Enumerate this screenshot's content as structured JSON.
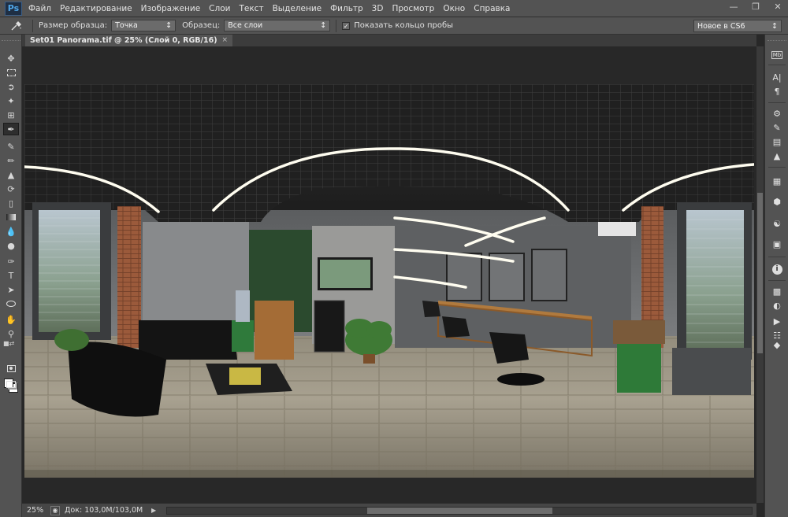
{
  "app": {
    "logo": "Ps"
  },
  "menu": [
    "Файл",
    "Редактирование",
    "Изображение",
    "Слои",
    "Текст",
    "Выделение",
    "Фильтр",
    "3D",
    "Просмотр",
    "Окно",
    "Справка"
  ],
  "window_controls": [
    "minimize-icon",
    "restore-icon",
    "close-icon"
  ],
  "options": {
    "tool_icon": "eyedropper-icon",
    "sample_size_label": "Размер образца:",
    "sample_size_value": "Точка",
    "sample_label": "Образец:",
    "sample_value": "Все слои",
    "show_ring_label": "Показать кольцо пробы",
    "show_ring_checked": true,
    "workspace_value": "Новое в CS6"
  },
  "document": {
    "tab_title": "Set01 Panorama.tif @ 25% (Слой 0, RGB/16)",
    "tab_close": "×",
    "image_description_icon": "panorama-photo"
  },
  "status": {
    "zoom": "25%",
    "doc_size": "Док: 103,0M/103,0M",
    "arrow": "▶"
  },
  "tools": [
    "move-icon",
    "marquee-icon",
    "lasso-icon",
    "magic-wand-icon",
    "crop-icon",
    "eyedropper-icon",
    "healing-brush-icon",
    "brush-icon",
    "clone-stamp-icon",
    "history-brush-icon",
    "eraser-icon",
    "gradient-icon",
    "blur-icon",
    "dodge-icon",
    "pen-icon",
    "type-icon",
    "path-selection-icon",
    "ellipse-icon",
    "hand-icon",
    "zoom-icon"
  ],
  "panels": [
    "mini-bridge-icon",
    "character-icon",
    "paragraph-icon",
    "adjustments-icon",
    "brush-presets-icon",
    "brushes-icon",
    "clone-source-icon",
    "3d-icon",
    "3d-materials-icon",
    "tool-presets-icon",
    "info-icon",
    "histogram-icon",
    "navigator-icon",
    "actions-icon",
    "layers-icon"
  ]
}
